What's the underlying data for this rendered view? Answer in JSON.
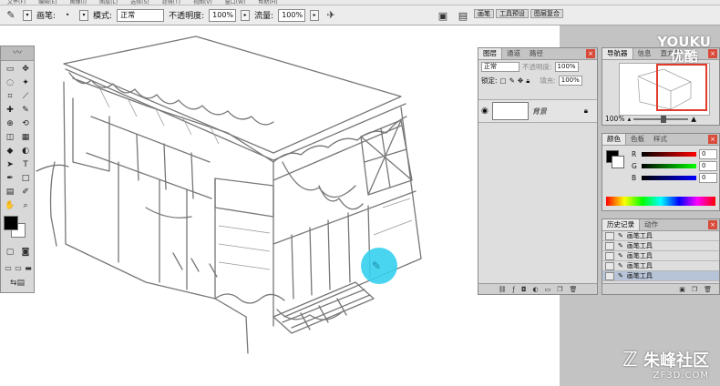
{
  "menubar": {
    "items": [
      "文件(F)",
      "编辑(E)",
      "图像(I)",
      "图层(L)",
      "选择(S)",
      "滤镜(T)",
      "视图(V)",
      "窗口(W)",
      "帮助(H)"
    ]
  },
  "options": {
    "brush_label": "画笔:",
    "mode_label": "模式:",
    "mode_value": "正常",
    "opacity_label": "不透明度:",
    "opacity_value": "100%",
    "flow_label": "流量:",
    "flow_value": "100%",
    "well_tabs": [
      "画笔",
      "工具预设",
      "图层复合"
    ]
  },
  "tools": {
    "icons": [
      "marquee-icon",
      "move-icon",
      "lasso-icon",
      "magic-wand-icon",
      "crop-icon",
      "slice-icon",
      "healing-icon",
      "brush-icon",
      "stamp-icon",
      "history-brush-icon",
      "eraser-icon",
      "gradient-icon",
      "blur-icon",
      "dodge-icon",
      "path-select-icon",
      "type-icon",
      "pen-icon",
      "shape-icon",
      "notes-icon",
      "eyedropper-icon",
      "hand-icon",
      "zoom-icon"
    ],
    "glyphs": [
      "▭",
      "✥",
      "◌",
      "✦",
      "⌗",
      "⟋",
      "✚",
      "✎",
      "⊕",
      "⟲",
      "◫",
      "▦",
      "◆",
      "◐",
      "➤",
      "T",
      "✒",
      "□",
      "▤",
      "✐",
      "✋",
      "⌕"
    ]
  },
  "layers_panel": {
    "tabs": [
      "图层",
      "通道",
      "路径"
    ],
    "blend_mode": "正常",
    "opacity_label": "不透明度:",
    "opacity_value": "100%",
    "lock_label": "锁定:",
    "fill_label": "填充:",
    "fill_value": "100%",
    "layer_name": "背景"
  },
  "navigator_panel": {
    "tabs": [
      "导航器",
      "信息",
      "直方图"
    ],
    "zoom_value": "100%"
  },
  "color_panel": {
    "tabs": [
      "颜色",
      "色板",
      "样式"
    ],
    "channels": [
      {
        "label": "R",
        "value": "0"
      },
      {
        "label": "G",
        "value": "0"
      },
      {
        "label": "B",
        "value": "0"
      }
    ]
  },
  "history_panel": {
    "tabs": [
      "历史记录",
      "动作"
    ],
    "items": [
      "画笔工具",
      "画笔工具",
      "画笔工具",
      "画笔工具",
      "画笔工具"
    ]
  },
  "watermarks": {
    "youku_line1": "YOUKU",
    "youku_line2": "优酷",
    "zf_line1": "朱峰社区",
    "zf_line2": "ZF3D.COM"
  }
}
